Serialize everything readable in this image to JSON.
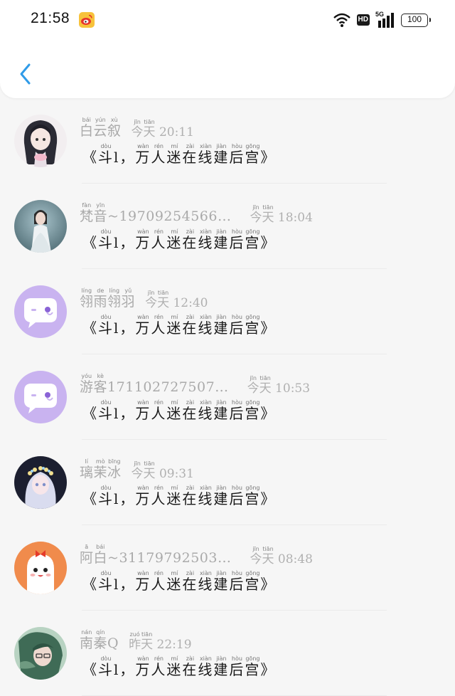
{
  "status_bar": {
    "time": "21:58",
    "hd_label": "HD",
    "network_label": "5G",
    "battery_level": "100"
  },
  "header": {
    "back_icon": "chevron-left-icon",
    "accent_color": "#2f9be8"
  },
  "messages": [
    {
      "name": "白云叙",
      "name_pinyin": [
        "bái",
        "yún",
        "xù"
      ],
      "time_day": "今天",
      "time_day_pinyin": [
        "jīn",
        "tiān"
      ],
      "time": "20:11",
      "avatar": "anime-boy-avatar"
    },
    {
      "name": "梵音~19709254566…",
      "name_pinyin": [
        "fàn",
        "yīn"
      ],
      "time_day": "今天",
      "time_day_pinyin": [
        "jīn",
        "tiān"
      ],
      "time": "18:04",
      "avatar": "girl-in-white-avatar"
    },
    {
      "name": "翎雨翎羽",
      "name_pinyin": [
        "líng",
        "de",
        "líng",
        "yǔ"
      ],
      "time_day": "今天",
      "time_day_pinyin": [
        "jīn",
        "tiān"
      ],
      "time": "12:40",
      "avatar": "default-chat-bubble-avatar"
    },
    {
      "name": "游客171102727507…",
      "name_pinyin": [
        "yóu",
        "kè"
      ],
      "time_day": "今天",
      "time_day_pinyin": [
        "jīn",
        "tiān"
      ],
      "time": "10:53",
      "avatar": "default-chat-bubble-avatar"
    },
    {
      "name": "璃茉冰",
      "name_pinyin": [
        "lí",
        "mò",
        "bīng"
      ],
      "time_day": "今天",
      "time_day_pinyin": [
        "jīn",
        "tiān"
      ],
      "time": "09:31",
      "avatar": "flower-crown-girl-avatar"
    },
    {
      "name": "阿白~31179792503…",
      "name_pinyin": [
        "ā",
        "bái"
      ],
      "time_day": "今天",
      "time_day_pinyin": [
        "jīn",
        "tiān"
      ],
      "time": "08:48",
      "avatar": "cute-ghost-avatar"
    },
    {
      "name": "南秦Q",
      "name_pinyin": [
        "nán",
        "qín"
      ],
      "time_day": "昨天",
      "time_day_pinyin": [
        "zuó",
        "tiān"
      ],
      "time": "22:19",
      "avatar": "green-hair-character-avatar"
    }
  ],
  "message_text": {
    "open_quote": "《",
    "chars": [
      "斗",
      "l，",
      "万",
      "人",
      "迷",
      "在",
      "线",
      "建",
      "后",
      "宫",
      "》"
    ],
    "pinyin": [
      "dòu",
      "",
      "wàn",
      "rén",
      "mí",
      "zài",
      "xiàn",
      "jiàn",
      "hòu",
      "gōng",
      ""
    ]
  }
}
